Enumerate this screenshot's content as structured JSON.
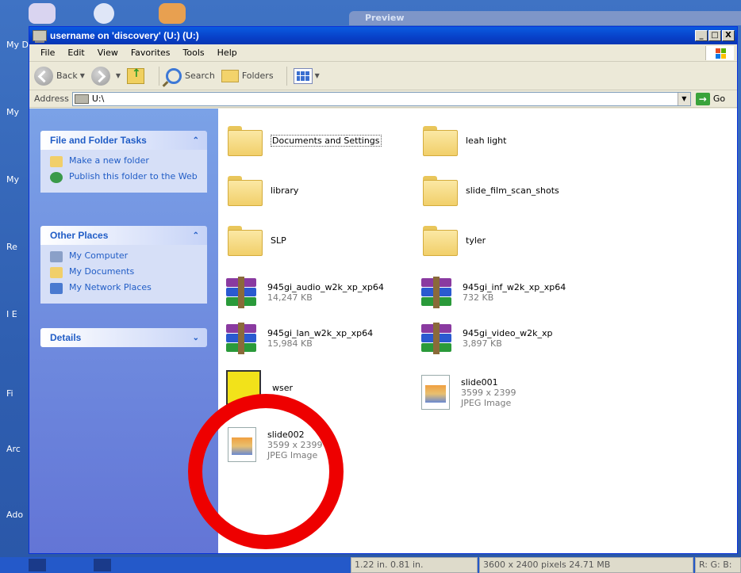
{
  "desktop": {
    "labels": [
      "My D",
      "My",
      "My",
      "Re",
      "I E",
      "Fi",
      "Arc",
      "Ado"
    ]
  },
  "background_window": {
    "title": "Preview"
  },
  "window": {
    "title": "username on 'discovery' (U:) (U:)",
    "buttons": {
      "minimize": "_",
      "maximize": "□",
      "close": "X"
    }
  },
  "menu": {
    "items": [
      "File",
      "Edit",
      "View",
      "Favorites",
      "Tools",
      "Help"
    ]
  },
  "toolbar": {
    "back_label": "Back",
    "search_label": "Search",
    "folders_label": "Folders"
  },
  "address": {
    "label": "Address",
    "value": "U:\\",
    "go_label": "Go"
  },
  "taskpane": {
    "file_tasks": {
      "title": "File and Folder Tasks",
      "items": [
        "Make a new folder",
        "Publish this folder to the Web"
      ]
    },
    "other_places": {
      "title": "Other Places",
      "items": [
        "My Computer",
        "My Documents",
        "My Network Places"
      ]
    },
    "details": {
      "title": "Details"
    }
  },
  "files": [
    {
      "name": "Documents and Settings",
      "type": "folder"
    },
    {
      "name": "leah light",
      "type": "folder"
    },
    {
      "name": "library",
      "type": "folder"
    },
    {
      "name": "slide_film_scan_shots",
      "type": "folder"
    },
    {
      "name": "SLP",
      "type": "folder"
    },
    {
      "name": "tyler",
      "type": "folder"
    },
    {
      "name": "945gi_audio_w2k_xp_xp64",
      "type": "archive",
      "size": "14,247 KB"
    },
    {
      "name": "945gi_inf_w2k_xp_xp64",
      "type": "archive",
      "size": "732 KB"
    },
    {
      "name": "945gi_lan_w2k_xp_xp64",
      "type": "archive",
      "size": "15,984 KB"
    },
    {
      "name": "945gi_video_w2k_xp",
      "type": "archive",
      "size": "3,897 KB"
    },
    {
      "name": "wser",
      "type": "app"
    },
    {
      "name": "slide001",
      "type": "image",
      "dims": "3599 x 2399",
      "kind": "JPEG Image"
    },
    {
      "name": "slide002",
      "type": "image",
      "dims": "3599 x 2399",
      "kind": "JPEG Image"
    }
  ],
  "statusbar": {
    "position": "1.22 in. 0.81 in.",
    "size": "3600 x 2400 pixels 24.71 MB",
    "rgb": "R: G: B:"
  },
  "colors": {
    "title_blue": "#0840c8",
    "task_link": "#215dc6",
    "annotation_ring": "#ee0000"
  }
}
